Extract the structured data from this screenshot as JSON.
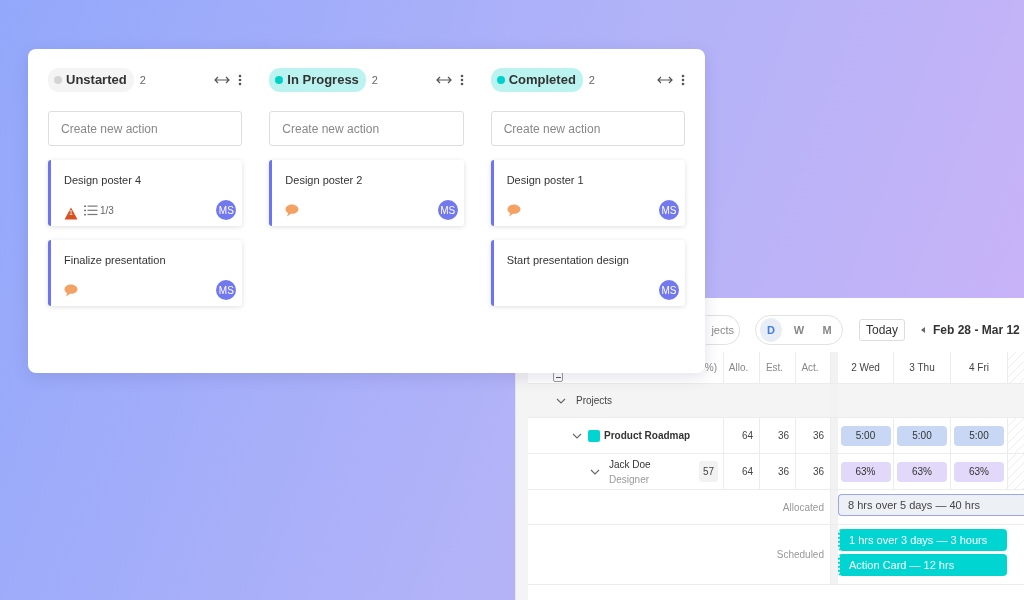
{
  "board": {
    "columns": [
      {
        "title": "Unstarted",
        "color": "#d4d4d4",
        "count": "2",
        "placeholder": "Create new action",
        "cards": [
          {
            "title": "Design poster 4",
            "badges": [
              {
                "kind": "warning",
                "text": "1"
              },
              {
                "kind": "checklist",
                "text": "1/3"
              }
            ],
            "assignee": "MS"
          },
          {
            "title": "Finalize presentation",
            "badges": [
              {
                "kind": "comment"
              }
            ],
            "assignee": "MS"
          }
        ]
      },
      {
        "title": "In Progress",
        "color": "#00d1c8",
        "count": "2",
        "placeholder": "Create new action",
        "cards": [
          {
            "title": "Design poster 2",
            "badges": [
              {
                "kind": "comment"
              }
            ],
            "assignee": "MS"
          }
        ]
      },
      {
        "title": "Completed",
        "color": "#00d1c8",
        "count": "2",
        "placeholder": "Create new action",
        "cards": [
          {
            "title": "Design poster 1",
            "badges": [
              {
                "kind": "comment"
              }
            ],
            "assignee": "MS"
          },
          {
            "title": "Start presentation design",
            "assignee": "MS"
          }
        ]
      }
    ]
  },
  "planner": {
    "filter": "jects",
    "views": [
      {
        "label": "D",
        "selected": true
      },
      {
        "label": "W",
        "selected": false
      },
      {
        "label": "M",
        "selected": false
      }
    ],
    "today": "Today",
    "range": "Feb 28 - Mar 12",
    "columns": [
      "%)",
      "Allo.",
      "Est.",
      "Act."
    ],
    "days": [
      "2 Wed",
      "3 Thu",
      "4 Fri"
    ],
    "rows": [
      {
        "kind": "group",
        "label": "Projects",
        "expanded": true
      },
      {
        "kind": "project",
        "label": "Product Roadmap",
        "color": "#00d5d0",
        "expanded": true,
        "values": [
          "64",
          "36",
          "36"
        ],
        "cells": [
          "5:00",
          "5:00",
          "5:00"
        ]
      },
      {
        "kind": "person",
        "label": "Jack Doe",
        "role": "Designer",
        "badge": "57",
        "expanded": true,
        "values": [
          "64",
          "36",
          "36"
        ],
        "cells": [
          "63%",
          "63%",
          "63%"
        ]
      },
      {
        "kind": "allocated",
        "label": "Allocated",
        "bars": [
          "8 hrs over 5 days — 40 hrs"
        ]
      },
      {
        "kind": "scheduled",
        "label": "Scheduled",
        "bars": [
          "1 hrs over 3 days — 3 hours",
          "Action Card — 12 hrs"
        ]
      }
    ]
  }
}
